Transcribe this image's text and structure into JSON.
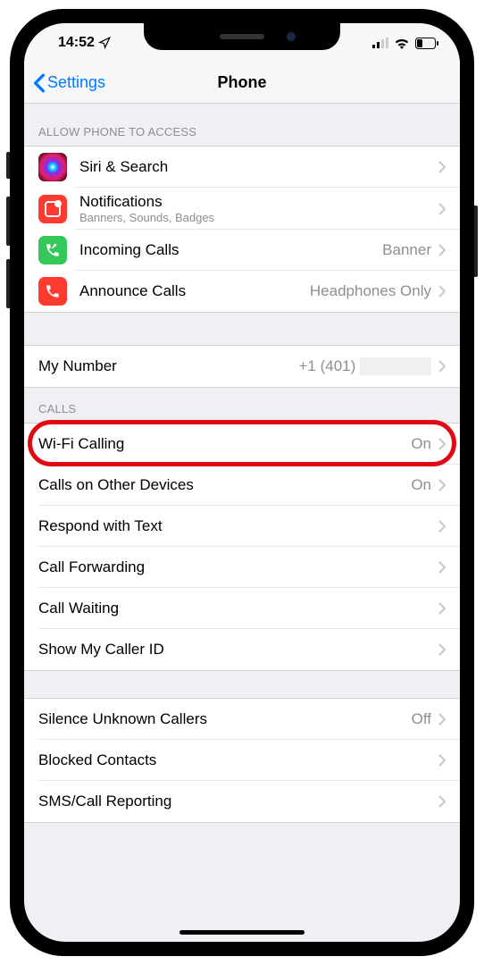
{
  "status_bar": {
    "time": "14:52"
  },
  "nav": {
    "back_label": "Settings",
    "title": "Phone"
  },
  "sections": {
    "access_header": "ALLOW PHONE TO ACCESS",
    "calls_header": "CALLS"
  },
  "access_items": {
    "siri": {
      "label": "Siri & Search"
    },
    "notifications": {
      "label": "Notifications",
      "sublabel": "Banners, Sounds, Badges"
    },
    "incoming": {
      "label": "Incoming Calls",
      "value": "Banner"
    },
    "announce": {
      "label": "Announce Calls",
      "value": "Headphones Only"
    }
  },
  "my_number": {
    "label": "My Number",
    "value": "+1 (401)"
  },
  "calls_items": {
    "wifi": {
      "label": "Wi-Fi Calling",
      "value": "On"
    },
    "other_devices": {
      "label": "Calls on Other Devices",
      "value": "On"
    },
    "respond": {
      "label": "Respond with Text"
    },
    "forwarding": {
      "label": "Call Forwarding"
    },
    "waiting": {
      "label": "Call Waiting"
    },
    "caller_id": {
      "label": "Show My Caller ID"
    }
  },
  "other_items": {
    "silence": {
      "label": "Silence Unknown Callers",
      "value": "Off"
    },
    "blocked": {
      "label": "Blocked Contacts"
    },
    "sms": {
      "label": "SMS/Call Reporting"
    }
  }
}
